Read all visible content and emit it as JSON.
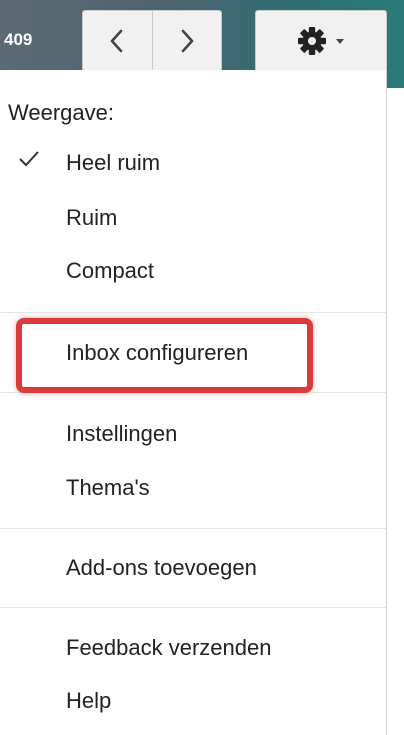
{
  "toolbar": {
    "count_text": "409",
    "prev_icon": "chevron-left-icon",
    "next_icon": "chevron-right-icon",
    "settings_icon": "gear-icon",
    "settings_caret_icon": "caret-down-icon"
  },
  "menu": {
    "header": "Weergave:",
    "density_items": [
      {
        "label": "Heel ruim",
        "checked": true
      },
      {
        "label": "Ruim",
        "checked": false
      },
      {
        "label": "Compact",
        "checked": false
      }
    ],
    "configure_inbox": "Inbox configureren",
    "settings": "Instellingen",
    "themes": "Thema's",
    "add_ons": "Add-ons toevoegen",
    "feedback": "Feedback verzenden",
    "help": "Help"
  },
  "annotation": {
    "highlight_color": "#d93a3a"
  }
}
